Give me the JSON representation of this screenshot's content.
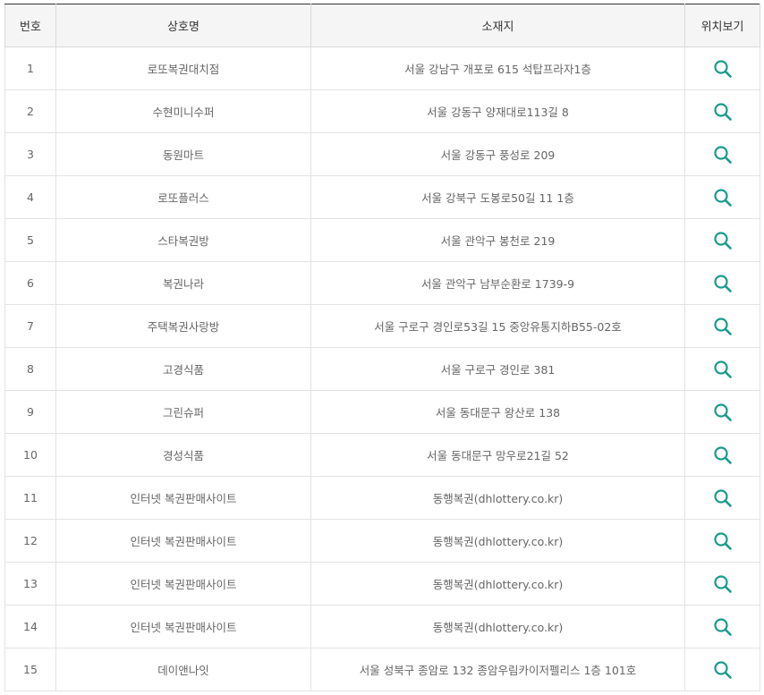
{
  "table": {
    "headers": {
      "number": "번호",
      "name": "상호명",
      "address": "소재지",
      "location": "위치보기"
    },
    "rows": [
      {
        "number": "1",
        "name": "로또복권대치점",
        "address": "서울 강남구 개포로 615 석탑프라자1층",
        "location_icon": "search-icon"
      },
      {
        "number": "2",
        "name": "수현미니수퍼",
        "address": "서울 강동구 양재대로113길 8",
        "location_icon": "search-icon"
      },
      {
        "number": "3",
        "name": "동원마트",
        "address": "서울 강동구 풍성로 209",
        "location_icon": "search-icon"
      },
      {
        "number": "4",
        "name": "로또플러스",
        "address": "서울 강북구 도봉로50길 11 1층",
        "location_icon": "search-icon"
      },
      {
        "number": "5",
        "name": "스타복권방",
        "address": "서울 관악구 봉천로 219",
        "location_icon": "search-icon"
      },
      {
        "number": "6",
        "name": "복권나라",
        "address": "서울 관악구 남부순환로 1739-9",
        "location_icon": "search-icon"
      },
      {
        "number": "7",
        "name": "주택복권사랑방",
        "address": "서울 구로구 경인로53길 15 중앙유통지하B55-02호",
        "location_icon": "search-icon"
      },
      {
        "number": "8",
        "name": "고경식품",
        "address": "서울 구로구 경인로 381",
        "location_icon": "search-icon"
      },
      {
        "number": "9",
        "name": "그린슈퍼",
        "address": "서울 동대문구 왕산로 138",
        "location_icon": "search-icon"
      },
      {
        "number": "10",
        "name": "경성식품",
        "address": "서울 동대문구 망우로21길 52",
        "location_icon": "search-icon"
      },
      {
        "number": "11",
        "name": "인터넷 복권판매사이트",
        "address": "동행복권(dhlottery.co.kr)",
        "location_icon": "search-icon"
      },
      {
        "number": "12",
        "name": "인터넷 복권판매사이트",
        "address": "동행복권(dhlottery.co.kr)",
        "location_icon": "search-icon"
      },
      {
        "number": "13",
        "name": "인터넷 복권판매사이트",
        "address": "동행복권(dhlottery.co.kr)",
        "location_icon": "search-icon"
      },
      {
        "number": "14",
        "name": "인터넷 복권판매사이트",
        "address": "동행복권(dhlottery.co.kr)",
        "location_icon": "search-icon"
      },
      {
        "number": "15",
        "name": "데이앤나잇",
        "address": "서울 성북구 종암로 132 종암우림카이저펠리스 1층 101호",
        "location_icon": "search-icon"
      }
    ]
  },
  "colors": {
    "accent_icon": "#1a9a8c",
    "header_bg": "#f5f5f5",
    "header_top_border": "#333333",
    "row_border": "#e3e3e3"
  }
}
